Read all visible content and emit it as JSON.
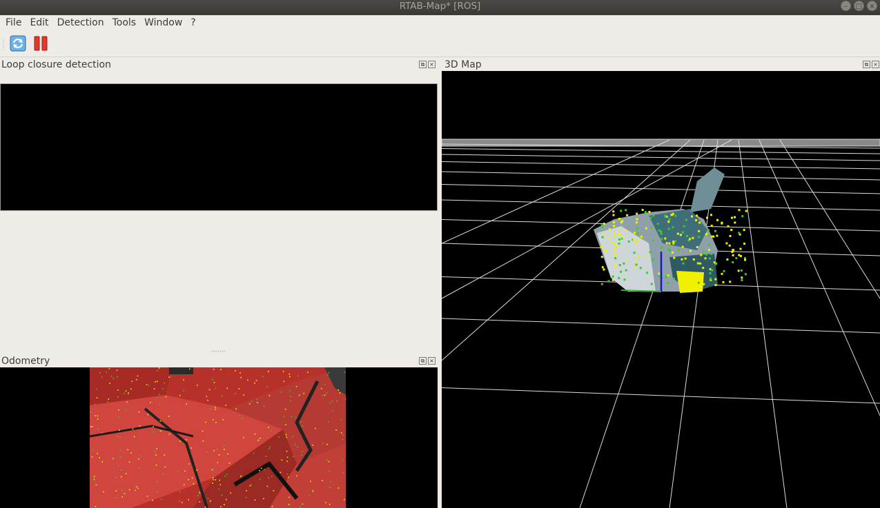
{
  "window": {
    "title": "RTAB-Map* [ROS]"
  },
  "menu": [
    "File",
    "Edit",
    "Detection",
    "Tools",
    "Window",
    "?"
  ],
  "toolbar": {
    "icons": [
      "refresh-icon",
      "pause-icon"
    ]
  },
  "docks": {
    "loop": {
      "title": "Loop closure detection"
    },
    "odometry": {
      "title": "Odometry"
    },
    "map3d": {
      "title": "3D Map"
    }
  },
  "colors": {
    "feature_yellow": "#f2f200",
    "feature_green": "#33cc33",
    "odometry_overlay": "#c0342e",
    "axis_blue": "#1818c8",
    "grid": "#e6e6e6"
  }
}
